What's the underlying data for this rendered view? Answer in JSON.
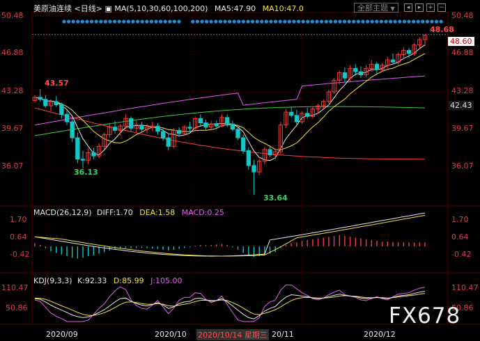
{
  "header": {
    "title": "美原油连续",
    "period": "<日线>",
    "ma_label": "MA(5,10,30,60,100,200)",
    "ma5_label": "MA5:47.90",
    "ma10_label": "MA10:47.0",
    "theme_button": "全部主题",
    "theme_arrow": "▼"
  },
  "price_axis": {
    "left_ticks": [
      "50.48",
      "46.88",
      "43.28",
      "39.67",
      "36.07"
    ],
    "right_ticks": [
      "50.48",
      "46.88",
      "43.28",
      "39.67",
      "36.07"
    ],
    "last_price_box": "48.60",
    "ma_box": "42.43"
  },
  "annotations": {
    "high_right": "48.68",
    "high_left": "43.57",
    "low_mid": "36.13",
    "low_bottom": "33.64"
  },
  "macd": {
    "header": "MACD(26,12,9)",
    "diff": "DIFF:1.70",
    "dea": "DEA:1.58",
    "macd": "MACD:0.25",
    "ticks_left": [
      "1.70",
      "0.64",
      "-0.42"
    ],
    "ticks_right": [
      "1.70",
      "0.64",
      "-0.42"
    ]
  },
  "kdj": {
    "header": "KDJ(9,3,3)",
    "k": "K:92.33",
    "d": "D:85.99",
    "j": "J:105.00",
    "ticks_left": [
      "110.47",
      "50.86"
    ],
    "ticks_right": [
      "110.47",
      "50.86"
    ]
  },
  "date_axis": {
    "labels": [
      "2020/09",
      "2020/10",
      "20/11",
      "2020/12"
    ],
    "highlight": "2020/10/14 星期三"
  },
  "watermark": "FX678",
  "colors": {
    "up": "#ff3b3b",
    "down": "#14c6c6",
    "ma5": "#e8e8e8",
    "ma10": "#f5e23a",
    "ma30": "#e55cf0",
    "ma60": "#3bd13b",
    "ma100": "#7a7a7a",
    "ma200": "#ff3b3b",
    "grid": "#5a0000"
  },
  "chart_data": {
    "type": "candlestick",
    "ylim": [
      33.0,
      50.48
    ],
    "ohlc": [
      [
        42.5,
        43.0,
        42.3,
        42.8
      ],
      [
        42.8,
        43.57,
        42.4,
        42.6
      ],
      [
        42.6,
        43.0,
        41.8,
        42.0
      ],
      [
        42.0,
        42.6,
        41.5,
        42.4
      ],
      [
        42.4,
        42.9,
        41.9,
        42.1
      ],
      [
        42.1,
        42.3,
        40.8,
        41.2
      ],
      [
        41.2,
        41.6,
        40.2,
        40.5
      ],
      [
        40.5,
        40.9,
        38.6,
        39.0
      ],
      [
        39.0,
        39.5,
        36.6,
        37.0
      ],
      [
        37.0,
        37.8,
        36.13,
        36.9
      ],
      [
        36.9,
        38.0,
        36.5,
        37.6
      ],
      [
        37.6,
        38.1,
        37.0,
        37.3
      ],
      [
        37.3,
        38.5,
        37.1,
        38.2
      ],
      [
        38.2,
        39.5,
        37.9,
        39.3
      ],
      [
        39.3,
        40.4,
        39.0,
        40.0
      ],
      [
        40.0,
        40.6,
        39.4,
        39.7
      ],
      [
        39.7,
        40.3,
        39.2,
        40.1
      ],
      [
        40.1,
        41.2,
        39.8,
        40.8
      ],
      [
        40.8,
        41.0,
        39.6,
        39.9
      ],
      [
        39.9,
        40.6,
        39.5,
        40.2
      ],
      [
        40.2,
        40.5,
        39.6,
        39.8
      ],
      [
        39.8,
        40.3,
        39.4,
        40.0
      ],
      [
        40.0,
        40.5,
        39.6,
        40.1
      ],
      [
        40.1,
        40.4,
        39.3,
        39.6
      ],
      [
        39.6,
        39.9,
        38.7,
        39.0
      ],
      [
        39.0,
        39.4,
        37.8,
        38.2
      ],
      [
        38.2,
        39.9,
        38.0,
        39.7
      ],
      [
        39.7,
        40.0,
        39.1,
        39.4
      ],
      [
        39.4,
        40.2,
        39.2,
        40.0
      ],
      [
        40.0,
        40.5,
        39.5,
        39.9
      ],
      [
        39.9,
        41.0,
        39.7,
        40.8
      ],
      [
        40.8,
        41.2,
        40.1,
        40.4
      ],
      [
        40.4,
        40.7,
        39.7,
        40.0
      ],
      [
        40.0,
        40.6,
        39.8,
        40.3
      ],
      [
        40.3,
        40.6,
        39.8,
        40.1
      ],
      [
        40.1,
        41.2,
        40.0,
        40.9
      ],
      [
        40.9,
        41.2,
        40.0,
        40.3
      ],
      [
        40.3,
        40.6,
        39.6,
        39.8
      ],
      [
        39.8,
        40.0,
        38.8,
        39.0
      ],
      [
        39.0,
        39.3,
        37.5,
        37.8
      ],
      [
        37.8,
        38.1,
        36.0,
        36.4
      ],
      [
        36.4,
        36.9,
        33.64,
        35.8
      ],
      [
        35.8,
        37.0,
        35.5,
        36.8
      ],
      [
        36.8,
        38.2,
        36.5,
        37.9
      ],
      [
        37.9,
        38.3,
        37.2,
        37.4
      ],
      [
        37.4,
        38.0,
        37.0,
        37.7
      ],
      [
        37.7,
        40.5,
        37.5,
        40.2
      ],
      [
        40.2,
        41.7,
        39.9,
        41.4
      ],
      [
        41.4,
        41.9,
        40.9,
        41.1
      ],
      [
        41.1,
        41.6,
        40.2,
        40.5
      ],
      [
        40.5,
        41.5,
        40.3,
        41.3
      ],
      [
        41.3,
        41.8,
        40.8,
        41.0
      ],
      [
        41.0,
        41.9,
        40.8,
        41.7
      ],
      [
        41.7,
        42.2,
        41.3,
        42.0
      ],
      [
        42.0,
        42.6,
        41.7,
        42.4
      ],
      [
        42.4,
        43.5,
        42.2,
        43.3
      ],
      [
        43.3,
        44.6,
        43.1,
        44.4
      ],
      [
        44.4,
        45.3,
        44.0,
        45.1
      ],
      [
        45.1,
        45.6,
        44.2,
        44.6
      ],
      [
        44.6,
        45.8,
        44.3,
        45.5
      ],
      [
        45.5,
        45.9,
        44.8,
        45.2
      ],
      [
        45.2,
        45.7,
        44.6,
        44.9
      ],
      [
        44.9,
        45.8,
        44.7,
        45.5
      ],
      [
        45.5,
        46.3,
        45.2,
        45.9
      ],
      [
        45.9,
        46.1,
        45.0,
        45.4
      ],
      [
        45.4,
        46.0,
        45.2,
        45.8
      ],
      [
        45.8,
        46.6,
        45.5,
        46.3
      ],
      [
        46.3,
        46.9,
        45.9,
        46.1
      ],
      [
        46.1,
        47.0,
        45.9,
        46.8
      ],
      [
        46.8,
        47.5,
        46.4,
        47.2
      ],
      [
        47.2,
        47.4,
        46.5,
        46.9
      ],
      [
        46.9,
        47.9,
        46.7,
        47.7
      ],
      [
        47.7,
        48.4,
        47.4,
        48.2
      ],
      [
        48.2,
        48.68,
        47.6,
        48.6
      ]
    ],
    "macd_hist": [
      0.2,
      0.1,
      -0.1,
      -0.3,
      -0.4,
      -0.5,
      -0.6,
      -0.7,
      -0.75,
      -0.7,
      -0.6,
      -0.55,
      -0.45,
      -0.35,
      -0.25,
      -0.2,
      -0.15,
      -0.1,
      -0.12,
      -0.1,
      -0.08,
      -0.1,
      -0.12,
      -0.15,
      -0.2,
      -0.25,
      -0.2,
      -0.15,
      -0.1,
      -0.05,
      0.05,
      0.1,
      0.08,
      0.1,
      0.12,
      0.15,
      0.1,
      -0.05,
      -0.2,
      -0.4,
      -0.55,
      -0.65,
      -0.6,
      -0.5,
      -0.45,
      -0.35,
      -0.1,
      0.1,
      0.2,
      0.25,
      0.35,
      0.4,
      0.45,
      0.5,
      0.55,
      0.6,
      0.65,
      0.7,
      0.65,
      0.6,
      0.55,
      0.5,
      0.45,
      0.4,
      0.35,
      0.3,
      0.3,
      0.28,
      0.26,
      0.25,
      0.25,
      0.24,
      0.25,
      0.25
    ],
    "kdj_k": [
      70,
      68,
      60,
      50,
      42,
      35,
      28,
      20,
      15,
      12,
      14,
      20,
      28,
      36,
      48,
      60,
      70,
      72,
      62,
      55,
      50,
      48,
      52,
      58,
      50,
      40,
      45,
      55,
      60,
      62,
      70,
      72,
      66,
      62,
      64,
      70,
      60,
      48,
      35,
      22,
      12,
      8,
      18,
      32,
      40,
      46,
      62,
      75,
      82,
      80,
      78,
      76,
      72,
      70,
      72,
      76,
      80,
      84,
      80,
      78,
      76,
      72,
      70,
      72,
      74,
      72,
      70,
      74,
      78,
      80,
      82,
      86,
      90,
      92.33
    ],
    "kdj_d": [
      72,
      71,
      68,
      62,
      55,
      48,
      42,
      35,
      28,
      22,
      19,
      19,
      22,
      27,
      34,
      43,
      52,
      59,
      60,
      58,
      55,
      53,
      53,
      55,
      53,
      48,
      47,
      50,
      53,
      56,
      61,
      65,
      65,
      64,
      64,
      66,
      64,
      58,
      50,
      41,
      31,
      23,
      21,
      25,
      30,
      36,
      45,
      55,
      64,
      70,
      73,
      74,
      73,
      72,
      72,
      73,
      75,
      78,
      79,
      78,
      77,
      75,
      73,
      73,
      73,
      73,
      72,
      73,
      75,
      77,
      79,
      81,
      84,
      85.99
    ]
  }
}
